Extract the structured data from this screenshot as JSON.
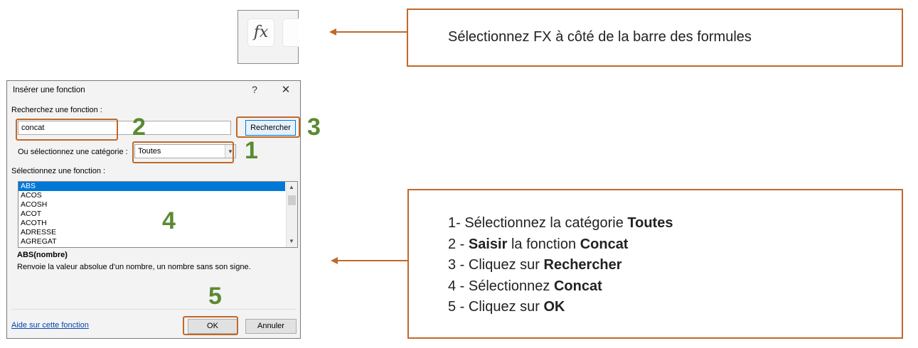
{
  "formula_snippet": {
    "fx_label": "fx"
  },
  "callout_top": {
    "text": "Sélectionnez FX à côté de la barre des formules"
  },
  "dialog": {
    "title": "Insérer une fonction",
    "help_glyph": "?",
    "close_glyph": "✕",
    "search_label": "Recherchez une fonction :",
    "search_value": "concat",
    "search_button": "Rechercher",
    "category_label": "Ou sélectionnez une catégorie :",
    "category_value": "Toutes",
    "select_label": "Sélectionnez une fonction :",
    "functions": [
      "ABS",
      "ACOS",
      "ACOSH",
      "ACOT",
      "ACOTH",
      "ADRESSE",
      "AGREGAT"
    ],
    "selected_function": "ABS",
    "syntax": "ABS(nombre)",
    "description": "Renvoie la valeur absolue d'un nombre, un nombre sans son signe.",
    "help_link": "Aide sur cette fonction",
    "ok_label": "OK",
    "cancel_label": "Annuler"
  },
  "markers": {
    "m1": "1",
    "m2": "2",
    "m3": "3",
    "m4": "4",
    "m5": "5"
  },
  "steps": [
    {
      "prefix": "1- Sélectionnez la catégorie ",
      "bold": "Toutes",
      "bold2_prefix": "",
      "bold2": ""
    },
    {
      "prefix": "2 - ",
      "bold": "Saisir",
      "bold2_prefix": " la fonction ",
      "bold2": "Concat"
    },
    {
      "prefix": "3 - Cliquez sur ",
      "bold": "Rechercher",
      "bold2_prefix": "",
      "bold2": ""
    },
    {
      "prefix": "4 - Sélectionnez ",
      "bold": "Concat",
      "bold2_prefix": "",
      "bold2": ""
    },
    {
      "prefix": "5 - Cliquez sur ",
      "bold": "OK",
      "bold2_prefix": "",
      "bold2": ""
    }
  ],
  "colors": {
    "callout_border": "#c0692a",
    "marker_green": "#5a8a32",
    "selection_blue": "#0078d7"
  }
}
